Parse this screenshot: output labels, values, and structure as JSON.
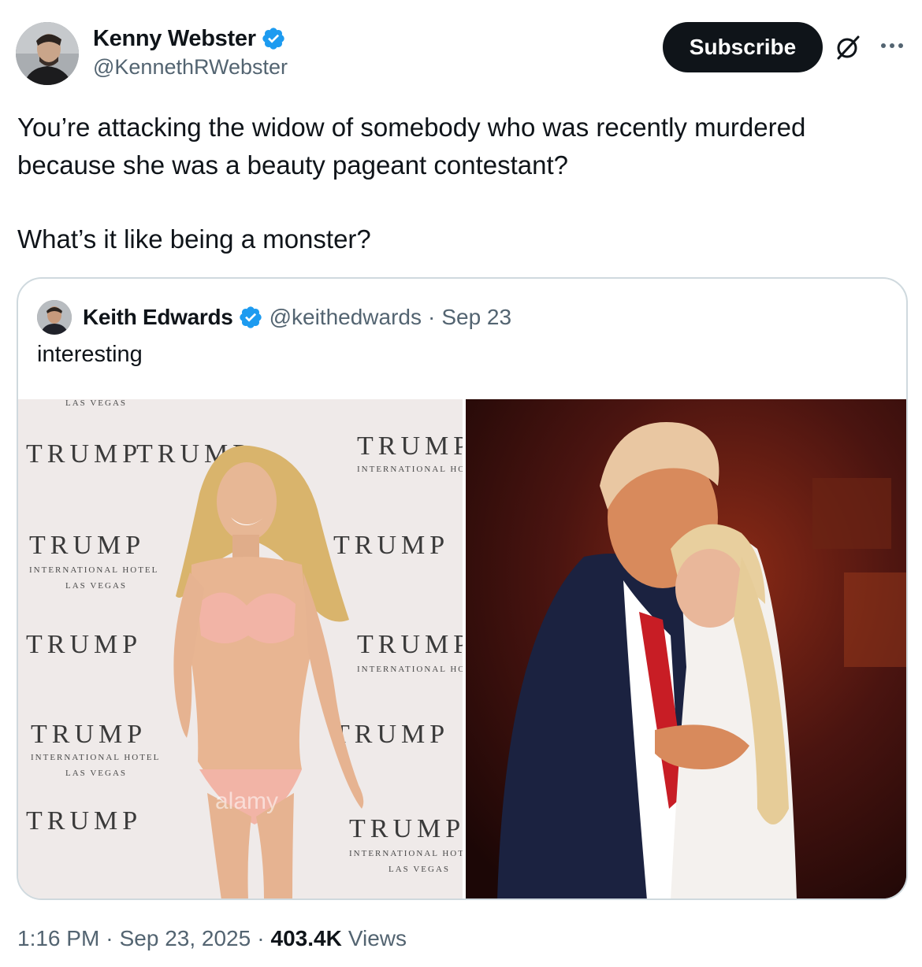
{
  "author": {
    "name": "Kenny Webster",
    "handle": "@KennethRWebster",
    "verified_color": "#1d9bf0"
  },
  "actions": {
    "subscribe_label": "Subscribe",
    "grok_icon": "grok-icon",
    "more_icon": "more-icon"
  },
  "tweet": {
    "line1": "You’re attacking the widow of somebody who was recently murdered because she was a beauty pageant contestant?",
    "line2": "What’s it like being a monster?"
  },
  "quote": {
    "name": "Keith Edwards",
    "handle": "@keithedwards",
    "separator": "·",
    "date": "Sep 23",
    "text": "interesting",
    "left_image_texts": {
      "t1": "TRUMP",
      "t2": "INTERNATIONAL HOTEL",
      "t3": "LAS VEGAS",
      "watermark": "alamy"
    }
  },
  "footer": {
    "time": "1:16 PM",
    "separator": "·",
    "date": "Sep 23, 2025",
    "views_count": "403.4K",
    "views_label": "Views"
  }
}
